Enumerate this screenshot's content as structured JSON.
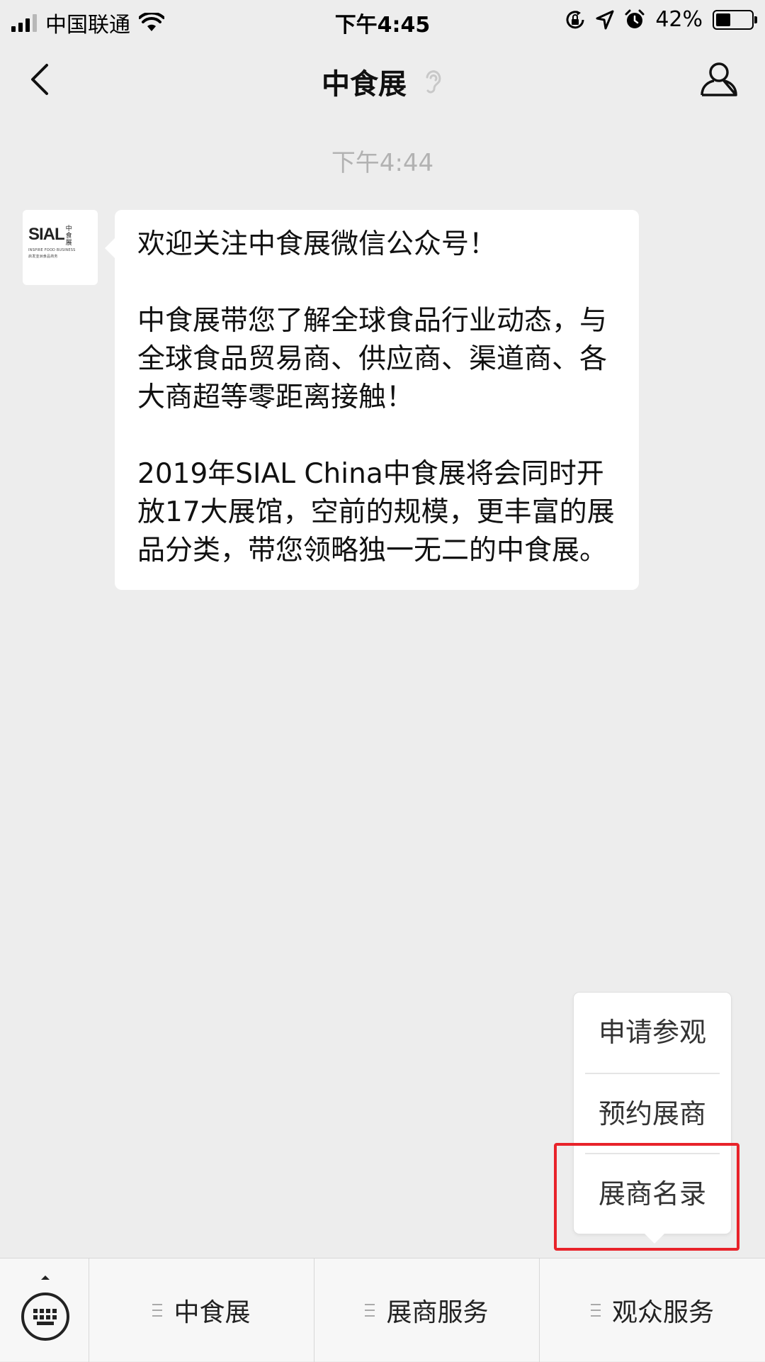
{
  "status_bar": {
    "carrier": "中国联通",
    "time": "下午4:45",
    "battery_percent": "42%",
    "battery_level": 0.42,
    "icons": [
      "signal-icon",
      "wifi-icon",
      "orientation-lock-icon",
      "location-icon",
      "alarm-icon",
      "battery-icon"
    ]
  },
  "nav": {
    "title": "中食展",
    "icons": [
      "back-arrow-icon",
      "ear-icon",
      "profile-icon"
    ]
  },
  "chat": {
    "timestamp": "下午4:44",
    "avatar": {
      "logo_text": "SIAL",
      "logo_cn": "中食展",
      "logo_sub": "INSPIRE FOOD BUSINESS",
      "logo_sub_cn": "启发亚洲食品商务"
    },
    "message": {
      "paragraph_1": "欢迎关注中食展微信公众号！",
      "paragraph_2": "中食展带您了解全球食品行业动态，与全球食品贸易商、供应商、渠道商、各大商超等零距离接触！",
      "paragraph_3": "2019年SIAL China中食展将会同时开放17大展馆，空前的规模，更丰富的展品分类，带您领略独一无二的中食展。"
    }
  },
  "popup_menu": {
    "items": [
      {
        "label": "申请参观"
      },
      {
        "label": "预约展商"
      },
      {
        "label": "展商名录"
      }
    ],
    "highlight_color": "#e8232a"
  },
  "bottom_menu": {
    "tabs": [
      {
        "label": "中食展"
      },
      {
        "label": "展商服务"
      },
      {
        "label": "观众服务"
      }
    ]
  }
}
